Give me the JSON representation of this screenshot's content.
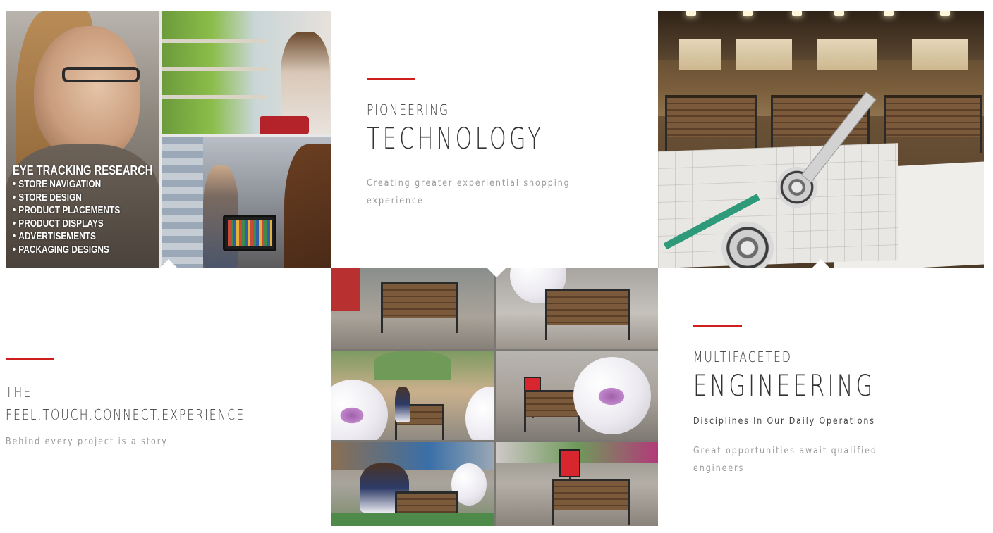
{
  "tiles": {
    "eye_tracking": {
      "title": "EYE TRACKING RESEARCH",
      "items": [
        "STORE NAVIGATION",
        "STORE DESIGN",
        "PRODUCT PLACEMENTS",
        "PRODUCT DISPLAYS",
        "ADVERTISEMENTS",
        "PACKAGING DESIGNS"
      ]
    },
    "technology": {
      "kicker": "PIONEERING",
      "headline": "TECHNOLOGY",
      "description": "Creating greater experiential shopping experience"
    },
    "experience": {
      "kicker_line1": "THE",
      "kicker_line2": "FEEL.TOUCH.CONNECT.EXPERIENCE",
      "description": "Behind every project is a story"
    },
    "engineering": {
      "kicker": "MULTIFACETED",
      "headline": "ENGINEERING",
      "subline": "Disciplines In Our Daily Operations",
      "description": "Great opportunities await qualified engineers"
    }
  },
  "colors": {
    "accent_red": "#cf1f1f",
    "heading_text": "#333333",
    "muted_text": "#9a9a9a",
    "background": "#ffffff"
  }
}
